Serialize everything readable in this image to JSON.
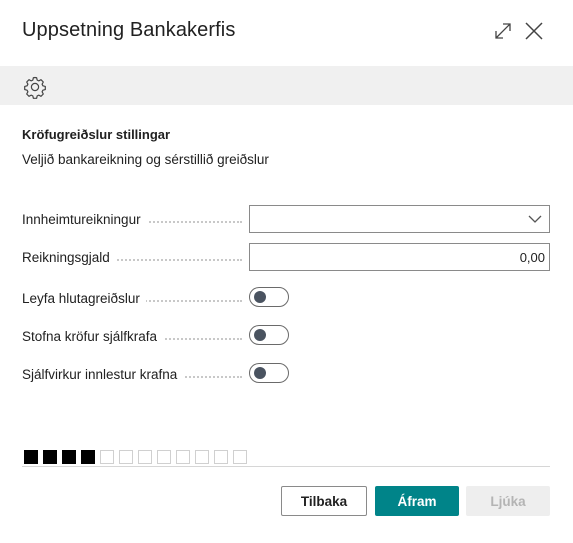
{
  "dialog": {
    "title": "Uppsetning Bankakerfis"
  },
  "section": {
    "title": "Kröfugreiðslur stillingar",
    "subtitle": "Veljið bankareikning og sérstillið greiðslur"
  },
  "fields": [
    {
      "label": "Innheimtureikningur",
      "type": "select",
      "value": ""
    },
    {
      "label": "Reikningsgjald",
      "type": "text",
      "value": "0,00"
    },
    {
      "label": "Leyfa hlutagreiðslur",
      "type": "toggle",
      "value": "off"
    },
    {
      "label": "Stofna kröfur sjálfkrafa",
      "type": "toggle",
      "value": "off"
    },
    {
      "label": "Sjálfvirkur innlestur krafna",
      "type": "toggle",
      "value": "off"
    }
  ],
  "progress": {
    "completed_steps": 4,
    "total_steps": 12
  },
  "buttons": {
    "back": "Tilbaka",
    "next": "Áfram",
    "finish": "Ljúka"
  },
  "colors": {
    "primary": "#008489",
    "toolbar_bg": "#f0f0f0",
    "disabled_bg": "#eeeeee"
  },
  "icons": [
    "expand-icon",
    "close-icon",
    "gear-icon",
    "chevron-down-icon"
  ]
}
